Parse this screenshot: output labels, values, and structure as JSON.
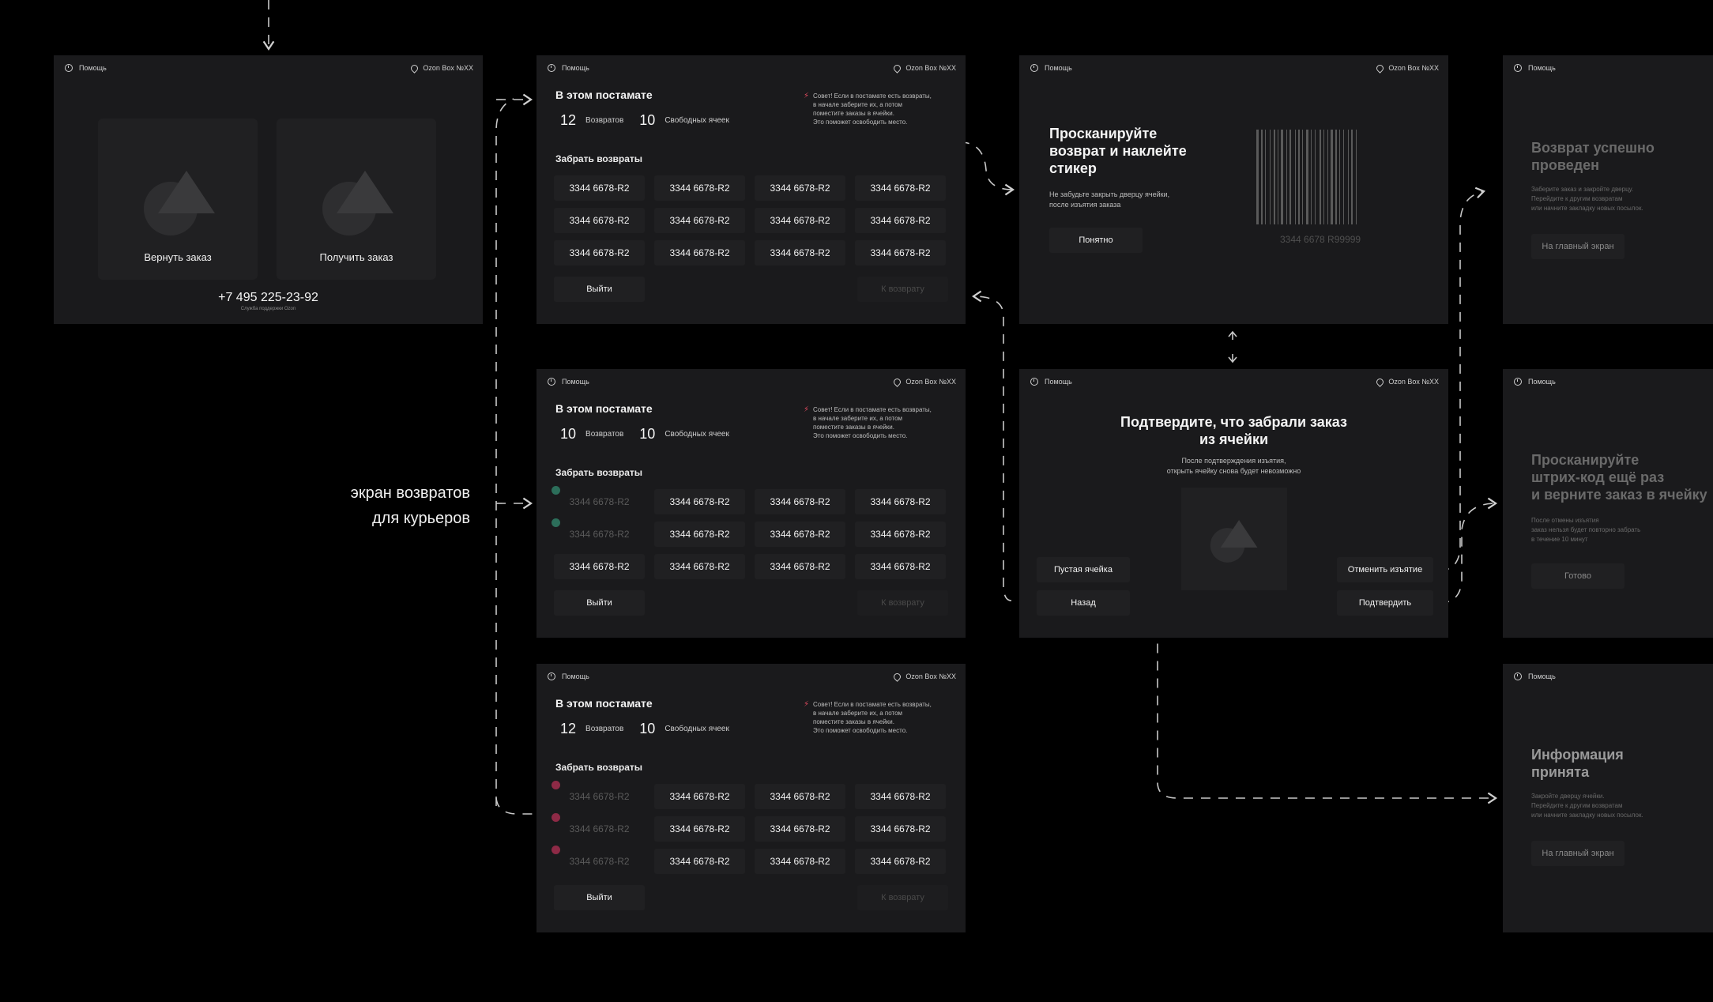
{
  "common": {
    "help": "Помощь",
    "location": "Ozon Box №XX"
  },
  "start": {
    "return_order": "Вернуть заказ",
    "get_order": "Получить заказ",
    "phone": "+7 495 225-23-92",
    "phone_sub": "Служба поддержки Ozon"
  },
  "side_label": [
    "экран возвратов",
    "для курьеров"
  ],
  "returns": {
    "title": "В этом постамате",
    "returns_label": "Возвратов",
    "free_label": "Свободных ячеек",
    "tip": [
      "Совет! Если в постамате есть возвраты,",
      "в начале заберите их, а потом",
      "поместите заказы в ячейки.",
      "Это поможет освободить место."
    ],
    "section": "Забрать возвраты",
    "code": "3344 6678-R2",
    "exit": "Выйти",
    "to_return": "К возврату",
    "screens": [
      {
        "returns_count": "12",
        "free_count": "10"
      },
      {
        "returns_count": "10",
        "free_count": "10"
      },
      {
        "returns_count": "12",
        "free_count": "10"
      }
    ]
  },
  "scan": {
    "title": [
      "Просканируйте",
      "возврат и наклейте",
      "стикер"
    ],
    "note": [
      "Не забудьте закрыть дверцу ячейки,",
      "после изъятия заказа"
    ],
    "ok": "Понятно",
    "barcode_number": "3344 6678 R99999"
  },
  "confirm": {
    "title": [
      "Подтвердите, что забрали заказ",
      "из ячейки"
    ],
    "note": [
      "После подтверждения изъятия,",
      "открыть ячейку снова будет невозможно"
    ],
    "empty_cell": "Пустая ячейка",
    "back": "Назад",
    "cancel": "Отменить изъятие",
    "confirm": "Подтвердить"
  },
  "success": {
    "title": [
      "Возврат успешно",
      "проведен"
    ],
    "note": [
      "Заберите заказ и закройте дверцу.",
      "Перейдите к другим возвратам",
      "или начните закладку новых посылок."
    ],
    "button": "На главный экран"
  },
  "rescan": {
    "title": [
      "Просканируйте",
      "штрих-код ещё раз",
      "и верните заказ в ячейку"
    ],
    "note": [
      "После отмены изъятия",
      "заказ нельзя будет повторно забрать",
      "в течение 10 минут"
    ],
    "button": "Готово"
  },
  "info": {
    "title": [
      "Информация",
      "принята"
    ],
    "note": [
      "Закройте дверцу ячейки.",
      "Перейдите к другим возвратам",
      "или начните закладку новых посылок."
    ],
    "button": "На главный экран"
  }
}
